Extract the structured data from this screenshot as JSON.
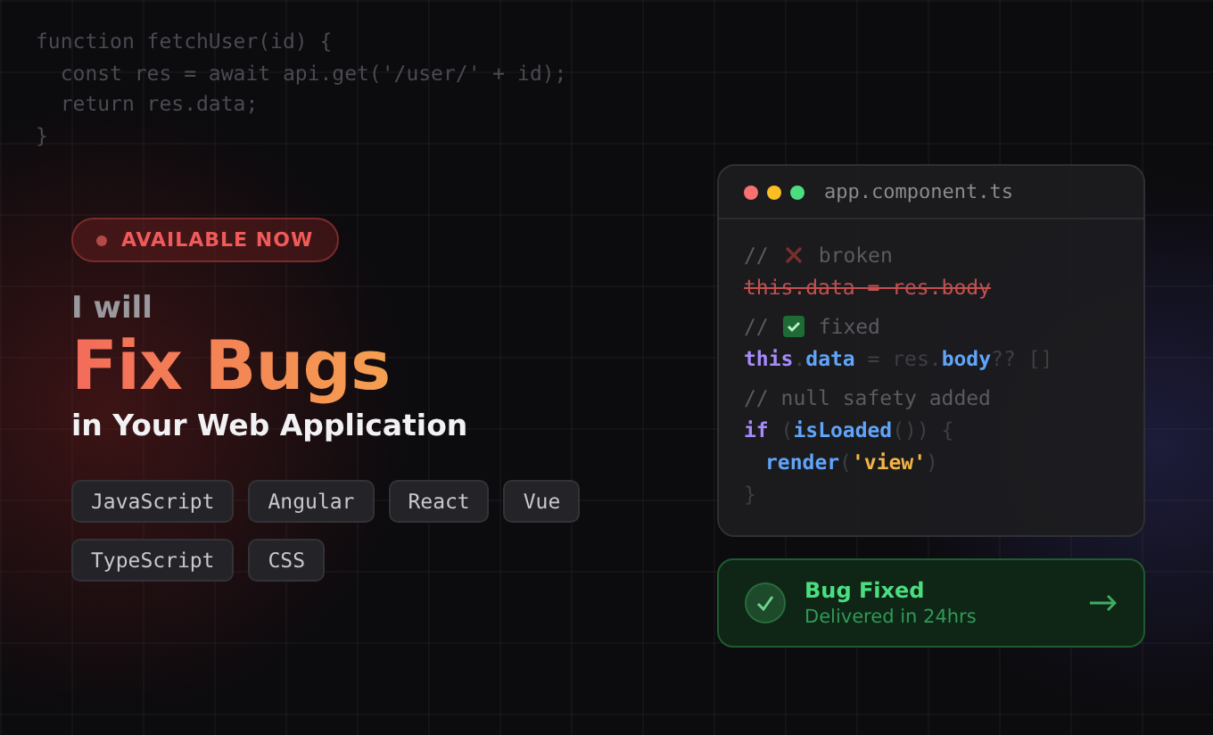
{
  "background_code": [
    "function fetchUser(id) {",
    "  const res = await api.get('/user/' + id);",
    "  return res.data;",
    "}"
  ],
  "badge": {
    "label": "AVAILABLE NOW"
  },
  "intro": "I will",
  "headline": "Fix Bugs",
  "subtitle": "in Your Web Application",
  "tags": [
    "JavaScript",
    "Angular",
    "React",
    "Vue",
    "TypeScript",
    "CSS"
  ],
  "editor": {
    "title": "app.component.ts",
    "lines": [
      {
        "kind": "comment",
        "fixed": false,
        "tokens": [
          {
            "kind": "comment",
            "text": "//"
          },
          {
            "kind": "comment",
            "text": "broken"
          }
        ]
      },
      {
        "kind": "struck",
        "tokens": [
          {
            "kind": "struck",
            "text": "this.data = res.body"
          }
        ]
      },
      {
        "kind": "comment",
        "fixed": true,
        "tokens": [
          {
            "kind": "comment",
            "text": "//"
          },
          {
            "kind": "comment",
            "text": "fixed"
          }
        ]
      },
      {
        "kind": "code",
        "tokens": [
          {
            "kind": "keyword",
            "text": "this"
          },
          {
            "kind": "dim",
            "text": "."
          },
          {
            "kind": "prop",
            "text": "data"
          },
          {
            "kind": "dim",
            "text": " = res."
          },
          {
            "kind": "prop",
            "text": "body"
          },
          {
            "kind": "dim",
            "text": "?? []"
          }
        ]
      },
      {
        "kind": "comment",
        "tokens": [
          {
            "kind": "comment",
            "text": "// null safety added"
          }
        ]
      },
      {
        "kind": "code",
        "tokens": [
          {
            "kind": "keyword",
            "text": "if"
          },
          {
            "kind": "dim",
            "text": " ("
          },
          {
            "kind": "prop",
            "text": "isLoaded"
          },
          {
            "kind": "dim",
            "text": "()) {"
          }
        ]
      },
      {
        "kind": "code",
        "indent": true,
        "tokens": [
          {
            "kind": "prop",
            "text": "render"
          },
          {
            "kind": "dim",
            "text": "("
          },
          {
            "kind": "string",
            "text": "'view'"
          },
          {
            "kind": "dim",
            "text": ")"
          }
        ]
      },
      {
        "kind": "code",
        "tokens": [
          {
            "kind": "dim",
            "text": "}"
          }
        ]
      }
    ]
  },
  "status": {
    "title": "Bug Fixed",
    "detail": "Delivered in 24hrs"
  }
}
